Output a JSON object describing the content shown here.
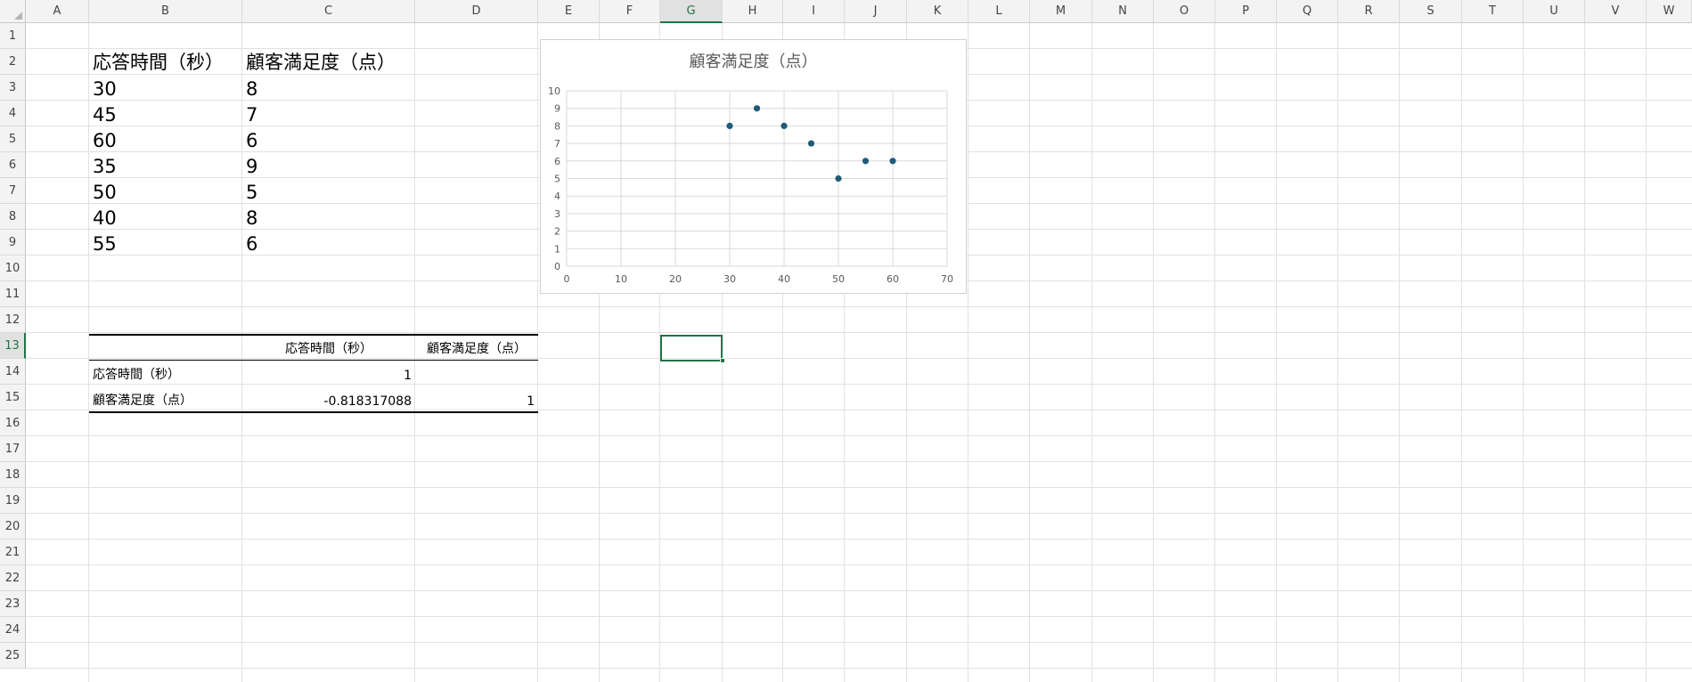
{
  "columns": [
    "A",
    "B",
    "C",
    "D",
    "E",
    "F",
    "G",
    "H",
    "I",
    "J",
    "K",
    "L",
    "M",
    "N",
    "O",
    "P",
    "Q",
    "R",
    "S",
    "T",
    "U",
    "V",
    "W"
  ],
  "selected_column": "G",
  "rows": [
    "1",
    "2",
    "3",
    "4",
    "5",
    "6",
    "7",
    "8",
    "9",
    "10",
    "11",
    "12",
    "13",
    "14",
    "15",
    "16",
    "17",
    "18",
    "19",
    "20",
    "21",
    "22",
    "23",
    "24",
    "25"
  ],
  "selected_row": "13",
  "data_table": {
    "header_b": "応答時間（秒）",
    "header_c": "顧客満足度（点）",
    "rows": [
      {
        "b": "30",
        "c": "8"
      },
      {
        "b": "45",
        "c": "7"
      },
      {
        "b": "60",
        "c": "6"
      },
      {
        "b": "35",
        "c": "9"
      },
      {
        "b": "50",
        "c": "5"
      },
      {
        "b": "40",
        "c": "8"
      },
      {
        "b": "55",
        "c": "6"
      }
    ]
  },
  "correlation_table": {
    "col1": "応答時間（秒）",
    "col2": "顧客満足度（点）",
    "row1_label": "応答時間（秒）",
    "row1_c": "1",
    "row2_label": "顧客満足度（点）",
    "row2_c": "-0.818317088",
    "row2_d": "1"
  },
  "colors": {
    "marker": "#1f5c7a",
    "grid": "#d9d9d9",
    "selection": "#217346"
  },
  "chart_data": {
    "type": "scatter",
    "title": "顧客満足度（点）",
    "x": [
      30,
      45,
      60,
      35,
      50,
      40,
      55
    ],
    "y": [
      8,
      7,
      6,
      9,
      5,
      8,
      6
    ],
    "xlim": [
      0,
      70
    ],
    "ylim": [
      0,
      10
    ],
    "xticks": [
      0,
      10,
      20,
      30,
      40,
      50,
      60,
      70
    ],
    "yticks": [
      0,
      1,
      2,
      3,
      4,
      5,
      6,
      7,
      8,
      9,
      10
    ],
    "xlabel": "",
    "ylabel": "",
    "grid": true,
    "legend": "none"
  }
}
